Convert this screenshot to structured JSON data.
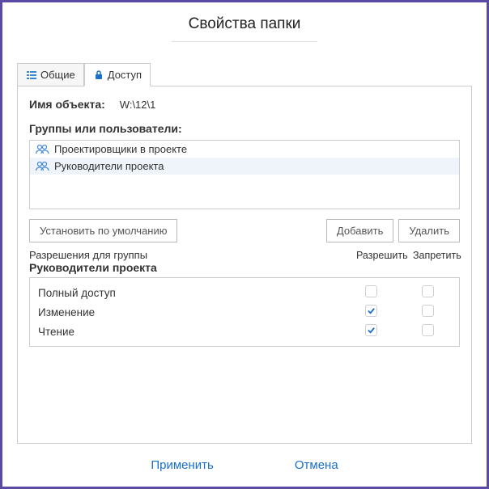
{
  "title": "Свойства папки",
  "tabs": {
    "general": "Общие",
    "access": "Доступ"
  },
  "object_name_label": "Имя объекта:",
  "object_name_value": "W:\\12\\1",
  "groups_label": "Группы или пользователи:",
  "groups": [
    {
      "name": "Проектировщики в проекте",
      "selected": false
    },
    {
      "name": "Руководители проекта",
      "selected": true
    }
  ],
  "buttons": {
    "set_default": "Установить по умолчанию",
    "add": "Добавить",
    "remove": "Удалить"
  },
  "perm_caption": "Разрешения для группы",
  "perm_group": "Руководители проекта",
  "perm_cols": {
    "allow": "Разрешить",
    "deny": "Запретить"
  },
  "permissions": [
    {
      "name": "Полный доступ",
      "allow": false,
      "deny": false
    },
    {
      "name": "Изменение",
      "allow": true,
      "deny": false
    },
    {
      "name": "Чтение",
      "allow": true,
      "deny": false
    }
  ],
  "footer": {
    "apply": "Применить",
    "cancel": "Отмена"
  }
}
